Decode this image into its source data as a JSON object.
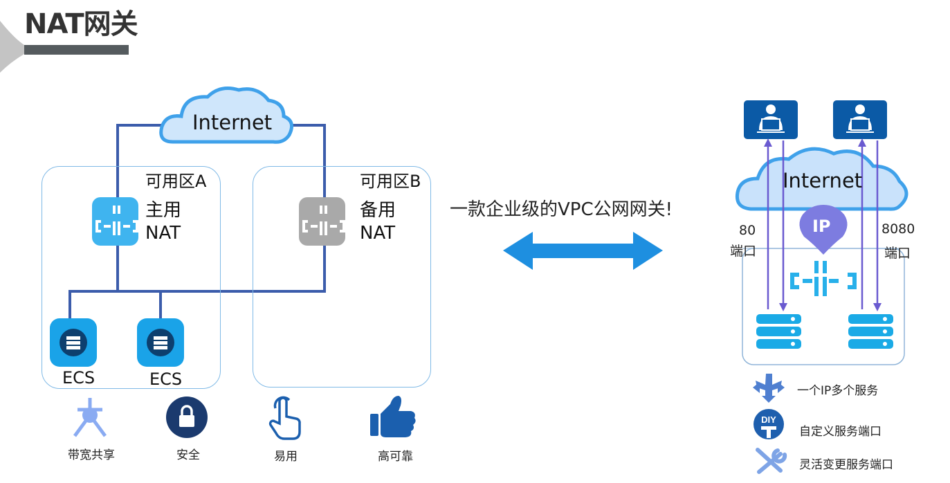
{
  "title": "NAT网关",
  "left_diagram": {
    "internet": "Internet",
    "zone_a": "可用区A",
    "zone_b": "可用区B",
    "primary_nat": {
      "line1": "主用",
      "line2": "NAT"
    },
    "backup_nat": {
      "line1": "备用",
      "line2": "NAT"
    },
    "ecs": [
      "ECS",
      "ECS"
    ]
  },
  "features_bottom": [
    "带宽共享",
    "安全",
    "易用",
    "高可靠"
  ],
  "tagline": "一款企业级的VPC公网网关!",
  "right_diagram": {
    "internet": "Internet",
    "ip_badge": "IP",
    "port_left": {
      "number": "80",
      "label": "端口"
    },
    "port_right": {
      "number": "8080",
      "label": "端口"
    }
  },
  "features_right": [
    "一个IP多个服务",
    "自定义服务端口",
    "灵活变更服务端口"
  ],
  "diy_badge": "DIY",
  "colors": {
    "line": "#3b5cab",
    "nat_primary": "#3fb4ef",
    "nat_backup": "#a9a9a9",
    "arrow": "#1e8fe0",
    "user_box": "#0b5aa6",
    "purple": "#6a5ad0",
    "ip_pin": "#7d7ce0"
  }
}
